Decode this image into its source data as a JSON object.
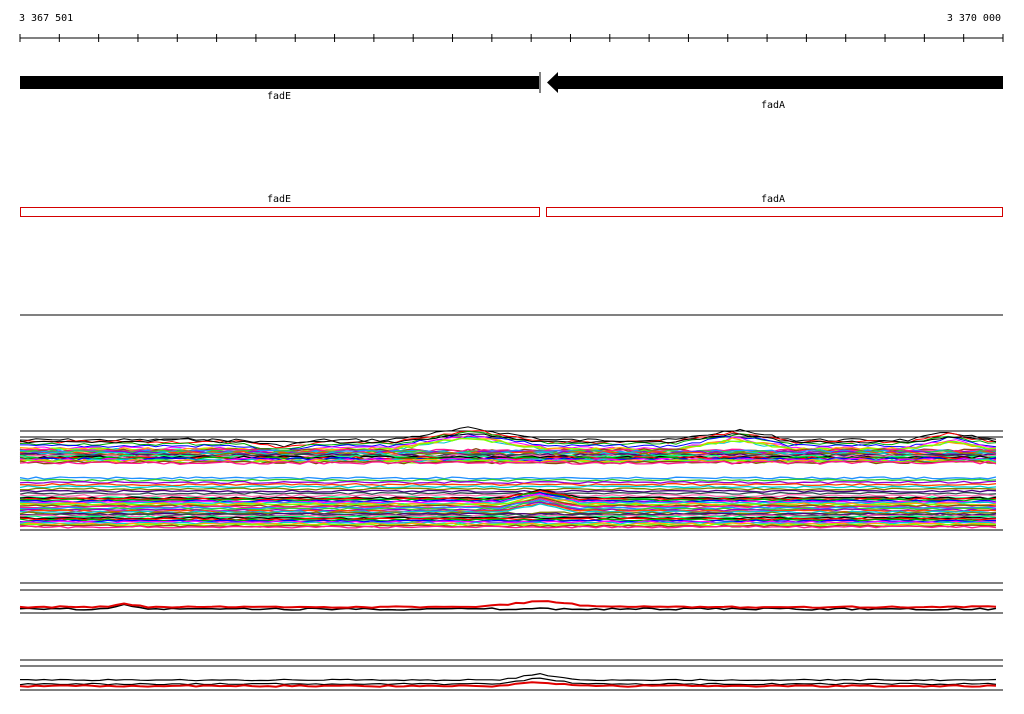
{
  "coordinates": {
    "start": "3 367 501",
    "end": "3 370 000"
  },
  "colors": {
    "gene_fill": "#000000",
    "cds_outline": "#d40000",
    "divider": "#000000",
    "trace_palette": [
      "#000000",
      "#ff0000",
      "#00aa00",
      "#0000ff",
      "#ff00ff",
      "#00cccc",
      "#ffaa00",
      "#7fff00",
      "#8b4513",
      "#ff1493",
      "#1e90ff",
      "#32cd32",
      "#9400d3",
      "#ff4500",
      "#00ced1",
      "#808000",
      "#4b0082",
      "#2f4f4f",
      "#ff69b4",
      "#00ff7f"
    ],
    "strand_a": "#000000",
    "strand_b": "#e00000"
  },
  "genes": [
    {
      "name": "fadE",
      "strand": "reverse"
    },
    {
      "name": "fadA",
      "strand": "reverse"
    }
  ],
  "cds_tracks": [
    {
      "name": "fadE"
    },
    {
      "name": "fadA"
    }
  ]
}
